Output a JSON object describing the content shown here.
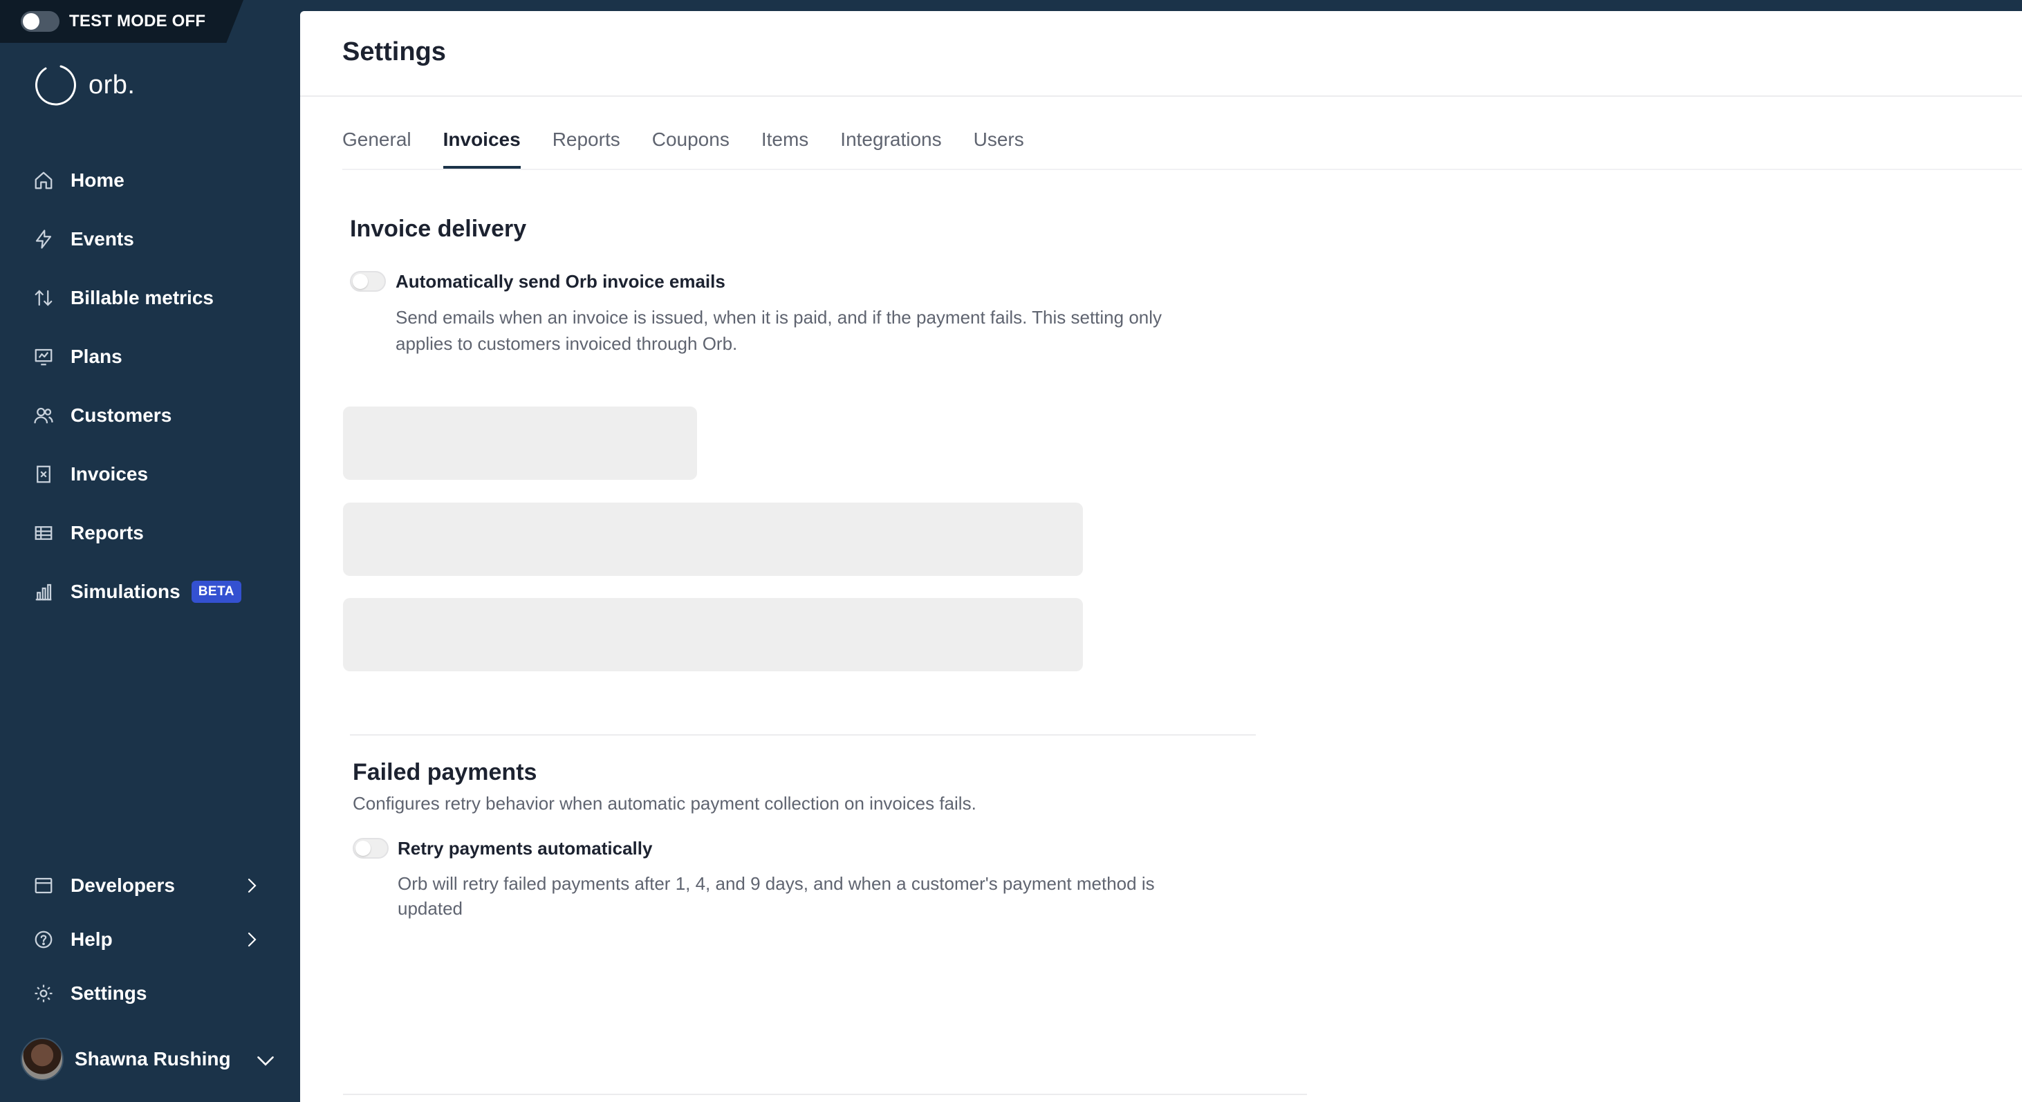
{
  "test_mode": {
    "label": "TEST MODE OFF",
    "enabled": false
  },
  "brand": {
    "name": "orb."
  },
  "sidebar": {
    "items": [
      {
        "label": "Home",
        "icon": "home-icon"
      },
      {
        "label": "Events",
        "icon": "bolt-icon"
      },
      {
        "label": "Billable metrics",
        "icon": "arrows-up-down-icon"
      },
      {
        "label": "Plans",
        "icon": "plans-icon"
      },
      {
        "label": "Customers",
        "icon": "users-icon"
      },
      {
        "label": "Invoices",
        "icon": "invoice-icon"
      },
      {
        "label": "Reports",
        "icon": "table-icon"
      },
      {
        "label": "Simulations",
        "icon": "bar-chart-icon",
        "badge": "BETA"
      }
    ],
    "bottom_items": [
      {
        "label": "Developers",
        "icon": "window-icon"
      },
      {
        "label": "Help",
        "icon": "help-icon"
      },
      {
        "label": "Settings",
        "icon": "gear-icon"
      }
    ],
    "user": {
      "name": "Shawna Rushing"
    }
  },
  "page": {
    "title": "Settings",
    "tabs": [
      "General",
      "Invoices",
      "Reports",
      "Coupons",
      "Items",
      "Integrations",
      "Users"
    ],
    "active_tab": "Invoices"
  },
  "invoice_delivery": {
    "title": "Invoice delivery",
    "toggle_label": "Automatically send Orb invoice emails",
    "toggle_on": false,
    "description_line1": "Send emails when an invoice is issued, when it is paid, and if the payment fails. This setting only",
    "description_line2": "applies to customers invoiced through Orb."
  },
  "failed_payments": {
    "title": "Failed payments",
    "subtitle": "Configures retry behavior when automatic payment collection on invoices fails.",
    "toggle_label": "Retry payments automatically",
    "toggle_on": false,
    "description_line1": "Orb will retry failed payments after 1, 4, and 9 days, and when a customer's payment method is",
    "description_line2": "updated"
  },
  "colors": {
    "sidebar_bg": "#1b3349",
    "accent_badge": "#3451d1",
    "skeleton": "#eeeeee"
  }
}
